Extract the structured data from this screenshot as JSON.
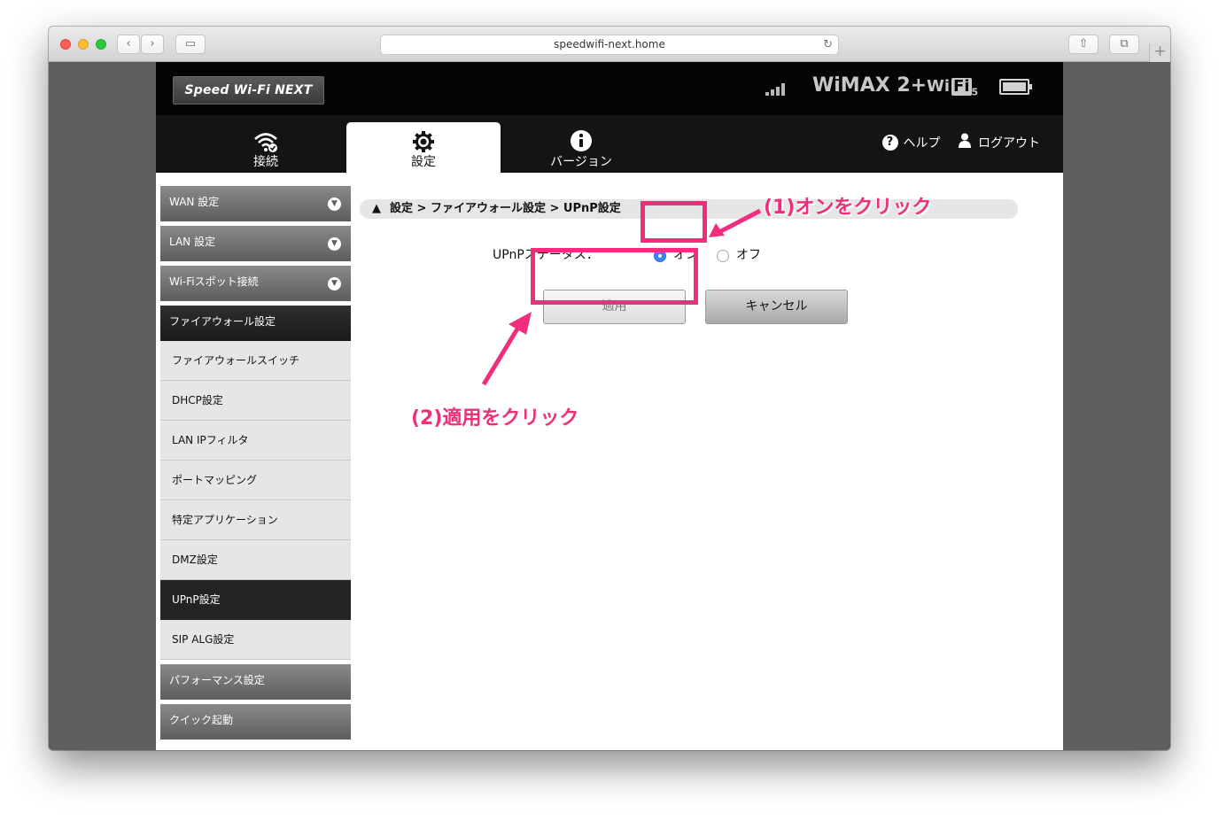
{
  "browser": {
    "url": "speedwifi-next.home",
    "nav_back": "‹",
    "nav_forward": "›",
    "sidebar_toggle": "▭",
    "reload": "↻",
    "share": "⇧",
    "tabs_overview": "⧉",
    "new_tab": "+"
  },
  "header": {
    "logo": "Speed Wi-Fi NEXT",
    "network": "WiMAX 2+",
    "wifi_brand": "Wi",
    "wifi_fi": "Fi",
    "wifi_sub": "5",
    "signal_icon": "signal-bars-icon",
    "battery_icon": "battery-icon"
  },
  "nav": {
    "tabs": [
      {
        "label": "接続",
        "icon": "wifi-icon"
      },
      {
        "label": "設定",
        "icon": "gear-icon"
      },
      {
        "label": "バージョン",
        "icon": "info-icon"
      }
    ],
    "help_icon_glyph": "?",
    "help": "ヘルプ",
    "logout": "ログアウト",
    "active_tab": "設定"
  },
  "sidebar": {
    "sections": [
      "WAN 設定",
      "LAN 設定",
      "Wi-Fiスポット接続"
    ],
    "firewall_header": "ファイアウォール設定",
    "firewall_items": [
      "ファイアウォールスイッチ",
      "DHCP設定",
      "LAN IPフィルタ",
      "ポートマッピング",
      "特定アプリケーション",
      "DMZ設定",
      "UPnP設定",
      "SIP ALG設定"
    ],
    "selected": "UPnP設定",
    "bottom_sections": [
      "パフォーマンス設定",
      "クイック起動"
    ]
  },
  "main": {
    "breadcrumb": "設定 > ファイアウォール設定 > UPnP設定",
    "status_label": "UPnPステータス：",
    "option_on": "オン",
    "option_off": "オフ",
    "status_selected": "オン",
    "apply": "適用",
    "cancel": "キャンセル"
  },
  "annotations": {
    "step1": "(1)オンをクリック",
    "step2": "(2)適用をクリック",
    "accent_color": "#ef2f7c"
  }
}
